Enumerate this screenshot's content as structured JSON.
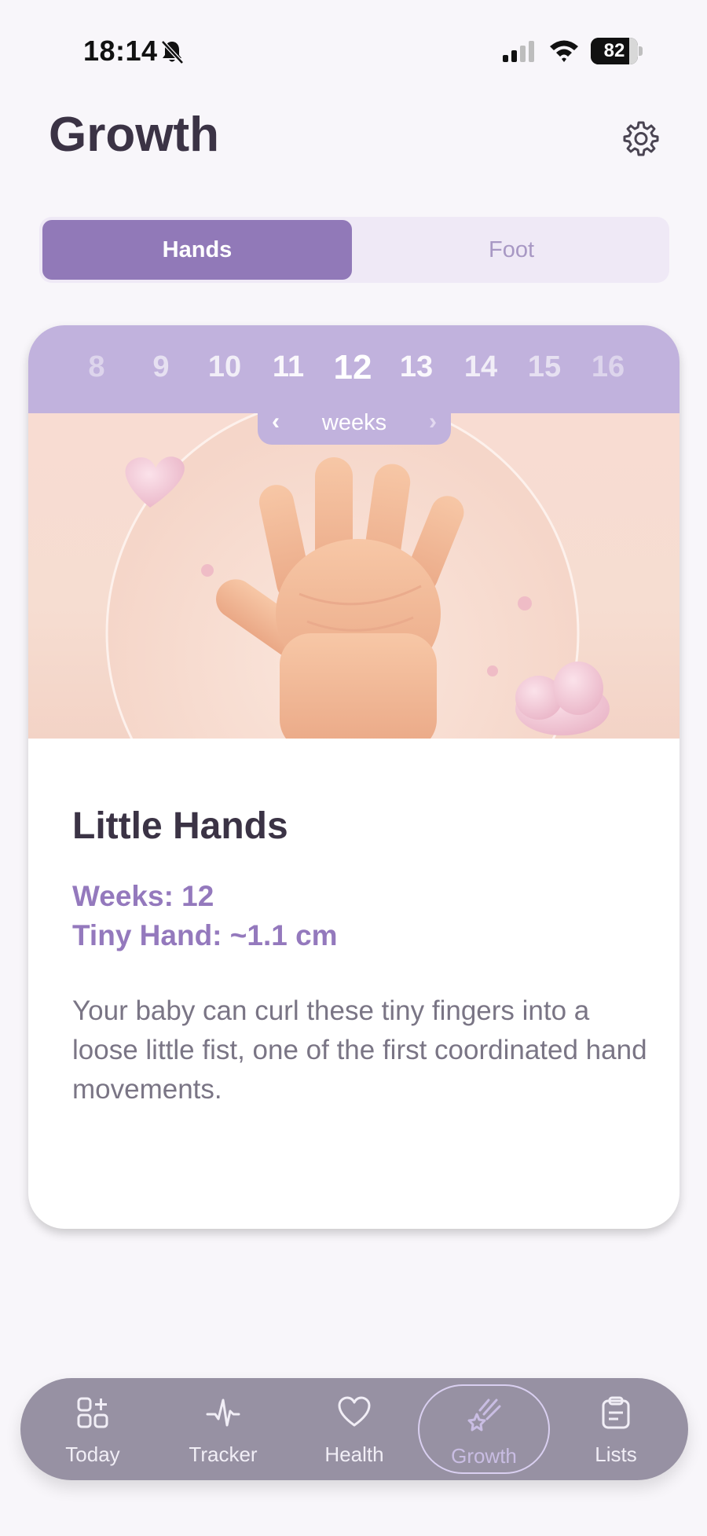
{
  "status_bar": {
    "time": "18:14",
    "battery": "82",
    "battery_level_percent": 82
  },
  "header": {
    "title": "Growth"
  },
  "segment": {
    "options": [
      "Hands",
      "Foot"
    ],
    "selected": "Hands"
  },
  "weeks": {
    "numbers": [
      "8",
      "9",
      "10",
      "11",
      "12",
      "13",
      "14",
      "15",
      "16"
    ],
    "selected": "12",
    "label": "weeks",
    "prev_glyph": "‹",
    "next_glyph": "›"
  },
  "card": {
    "title": "Little Hands",
    "weeks_line": "Weeks: 12",
    "size_line": "Tiny Hand: ~1.1 cm",
    "description": "Your baby can curl these tiny fingers into a loose little fist, one of the first coordinated hand movements."
  },
  "nav": {
    "items": [
      {
        "label": "Today",
        "icon": "today-grid-icon"
      },
      {
        "label": "Tracker",
        "icon": "pulse-icon"
      },
      {
        "label": "Health",
        "icon": "heart-icon"
      },
      {
        "label": "Growth",
        "icon": "shooting-star-icon"
      },
      {
        "label": "Lists",
        "icon": "clipboard-icon"
      }
    ],
    "active": "Growth"
  },
  "colors": {
    "accent": "#9179b8",
    "accent_light": "#efe9f6",
    "week_strip": "#c1b2dd",
    "nav_bg": "#9791a3",
    "highlight_text": "#9479bd"
  }
}
